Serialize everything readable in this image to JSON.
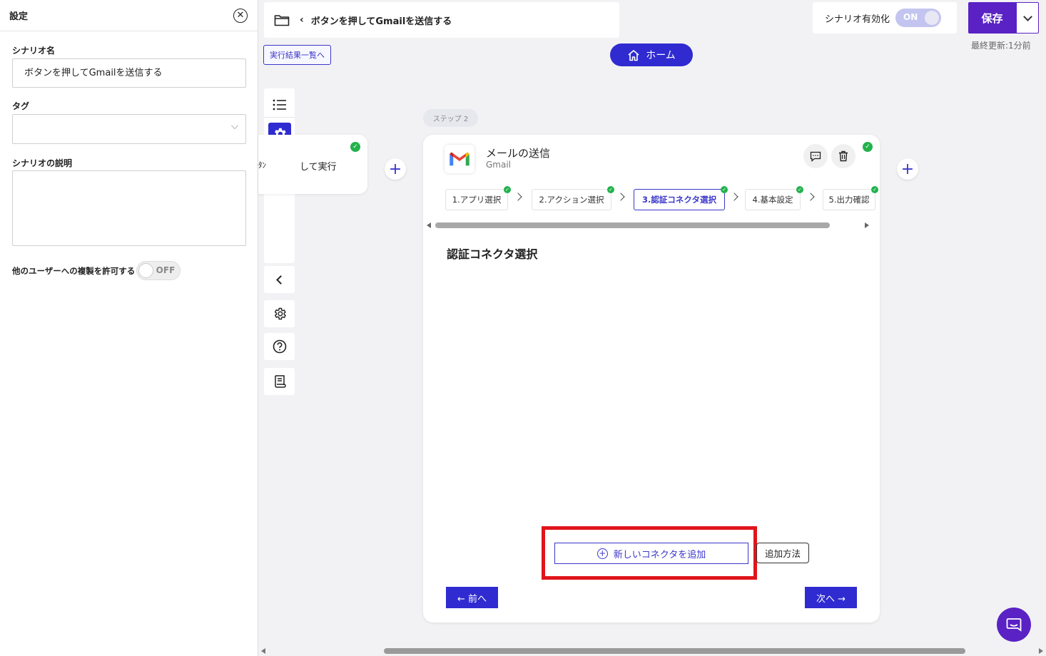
{
  "settings": {
    "title": "設定",
    "scenario_name_label": "シナリオ名",
    "scenario_name_value": "ボタンを押してGmailを送信する",
    "tag_label": "タグ",
    "tag_value": "",
    "description_label": "シナリオの説明",
    "description_value": "",
    "allow_copy_label": "他のユーザーへの複製を許可する",
    "allow_copy_state": "OFF"
  },
  "header": {
    "title": "ボタンを押してGmailを送信する",
    "results_link": "実行結果一覧へ",
    "home_label": "ホーム",
    "enable_label": "シナリオ有効化",
    "enable_state": "ON",
    "save_label": "保存",
    "last_updated": "最終更新:1分前"
  },
  "step1": {
    "text_fragment": "して実行",
    "clipped_prefix": "ﾀﾝ"
  },
  "step_card": {
    "chip": "ステップ 2",
    "title": "メールの送信",
    "app_name": "Gmail",
    "tabs": [
      {
        "label": "1.アプリ選択",
        "done": true,
        "active": false
      },
      {
        "label": "2.アクション選択",
        "done": true,
        "active": false
      },
      {
        "label": "3.認証コネクタ選択",
        "done": true,
        "active": true
      },
      {
        "label": "4.基本設定",
        "done": true,
        "active": false
      },
      {
        "label": "5.出力確認",
        "done": true,
        "active": false
      }
    ],
    "section_title": "認証コネクタ選択",
    "add_connector_label": "新しいコネクタを追加",
    "howto_label": "追加方法",
    "prev_label": "← 前へ",
    "next_label": "次へ →"
  },
  "colors": {
    "primary": "#2f2bd1",
    "save_purple": "#5a22c4",
    "success": "#22b24c",
    "highlight": "#e0151b"
  }
}
